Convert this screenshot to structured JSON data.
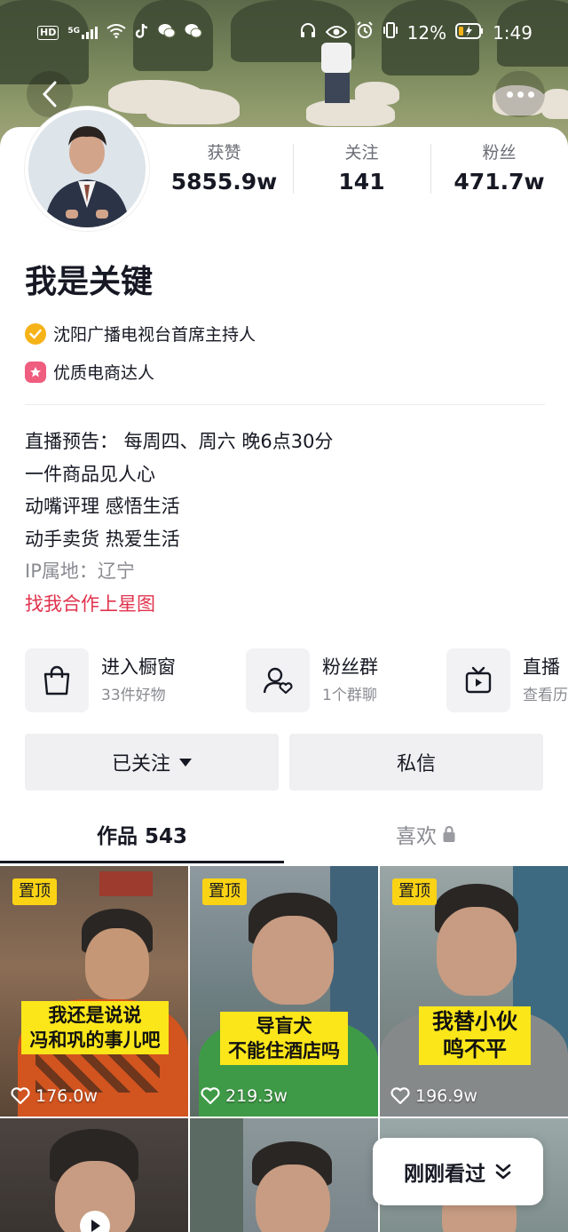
{
  "status_bar": {
    "network_badge": "HD",
    "signal_label": "5G",
    "battery": "12%",
    "time": "1:49"
  },
  "profile": {
    "nickname": "我是关键",
    "stats": [
      {
        "label": "获赞",
        "value": "5855.9w"
      },
      {
        "label": "关注",
        "value": "141"
      },
      {
        "label": "粉丝",
        "value": "471.7w"
      }
    ],
    "verification": "沈阳广播电视台首席主持人",
    "merchant_badge": "优质电商达人",
    "bio_lines": [
      "直播预告： 每周四、周六 晚6点30分",
      "一件商品见人心",
      "动嘴评理 感悟生活",
      "动手卖货 热爱生活"
    ],
    "ip_location": "IP属地：辽宁",
    "cooperation_link": "找我合作上星图"
  },
  "shortcuts": [
    {
      "title": "进入橱窗",
      "subtitle": "33件好物",
      "icon": "shopping-bag-icon"
    },
    {
      "title": "粉丝群",
      "subtitle": "1个群聊",
      "icon": "fan-group-icon"
    },
    {
      "title": "直播",
      "subtitle": "查看历",
      "icon": "tv-icon"
    }
  ],
  "actions": {
    "follow_label": "已关注",
    "message_label": "私信"
  },
  "tabs": [
    {
      "label": "作品 543",
      "active": true
    },
    {
      "label": "喜欢",
      "active": false
    }
  ],
  "videos": [
    {
      "pinned": "置顶",
      "caption": [
        "我还是说说",
        "冯和巩的事儿吧"
      ],
      "likes": "176.0w"
    },
    {
      "pinned": "置顶",
      "caption": [
        "导盲犬",
        "不能住酒店吗"
      ],
      "likes": "219.3w"
    },
    {
      "pinned": "置顶",
      "caption": [
        "我替小伙",
        "鸣不平"
      ],
      "likes": "196.9w"
    }
  ],
  "recently_viewed_label": "刚刚看过",
  "colors": {
    "accent_red": "#e0334d",
    "pin_yellow": "#fbd315",
    "verified_orange": "#f6b318",
    "merchant_pink": "#ef5d7f"
  }
}
